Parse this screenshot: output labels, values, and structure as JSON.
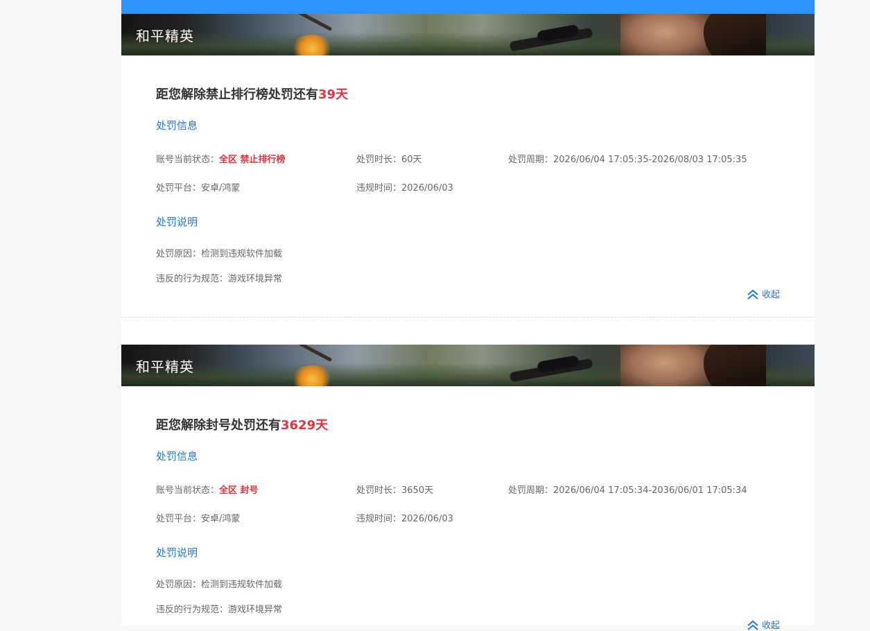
{
  "theme": {
    "accent": "#2e92ff",
    "link": "#1e78e6",
    "alert": "#e5323e"
  },
  "cards": [
    {
      "game": "和平精英",
      "headline_prefix": "距您解除禁止排行榜处罚还有",
      "headline_days": "39天",
      "info_title": "处罚信息",
      "status_label": "账号当前状态：",
      "status_value": "全区 禁止排行榜",
      "duration_label": "处罚时长：",
      "duration_value": "60天",
      "period_label": "处罚周期：",
      "period_value": "2026/06/04 17:05:35-2026/08/03 17:05:35",
      "platform_label": "处罚平台：",
      "platform_value": "安卓/鸿蒙",
      "violation_time_label": "违规时间：",
      "violation_time_value": "2026/06/03",
      "desc_title": "处罚说明",
      "reason_label": "处罚原因：",
      "reason_value": "检测到违规软件加载",
      "rule_label": "违反的行为规范：",
      "rule_value": "游戏环境异常",
      "collapse_label": "收起",
      "collapse_icon": "chevron-double-up-icon"
    },
    {
      "game": "和平精英",
      "headline_prefix": "距您解除封号处罚还有",
      "headline_days": "3629天",
      "info_title": "处罚信息",
      "status_label": "账号当前状态：",
      "status_value": "全区 封号",
      "duration_label": "处罚时长：",
      "duration_value": "3650天",
      "period_label": "处罚周期：",
      "period_value": "2026/06/04 17:05:34-2036/06/01 17:05:34",
      "platform_label": "处罚平台：",
      "platform_value": "安卓/鸿蒙",
      "violation_time_label": "违规时间：",
      "violation_time_value": "2026/06/03",
      "desc_title": "处罚说明",
      "reason_label": "处罚原因：",
      "reason_value": "检测到违规软件加载",
      "rule_label": "违反的行为规范：",
      "rule_value": "游戏环境异常",
      "collapse_label": "收起",
      "collapse_icon": "chevron-double-up-icon"
    }
  ]
}
